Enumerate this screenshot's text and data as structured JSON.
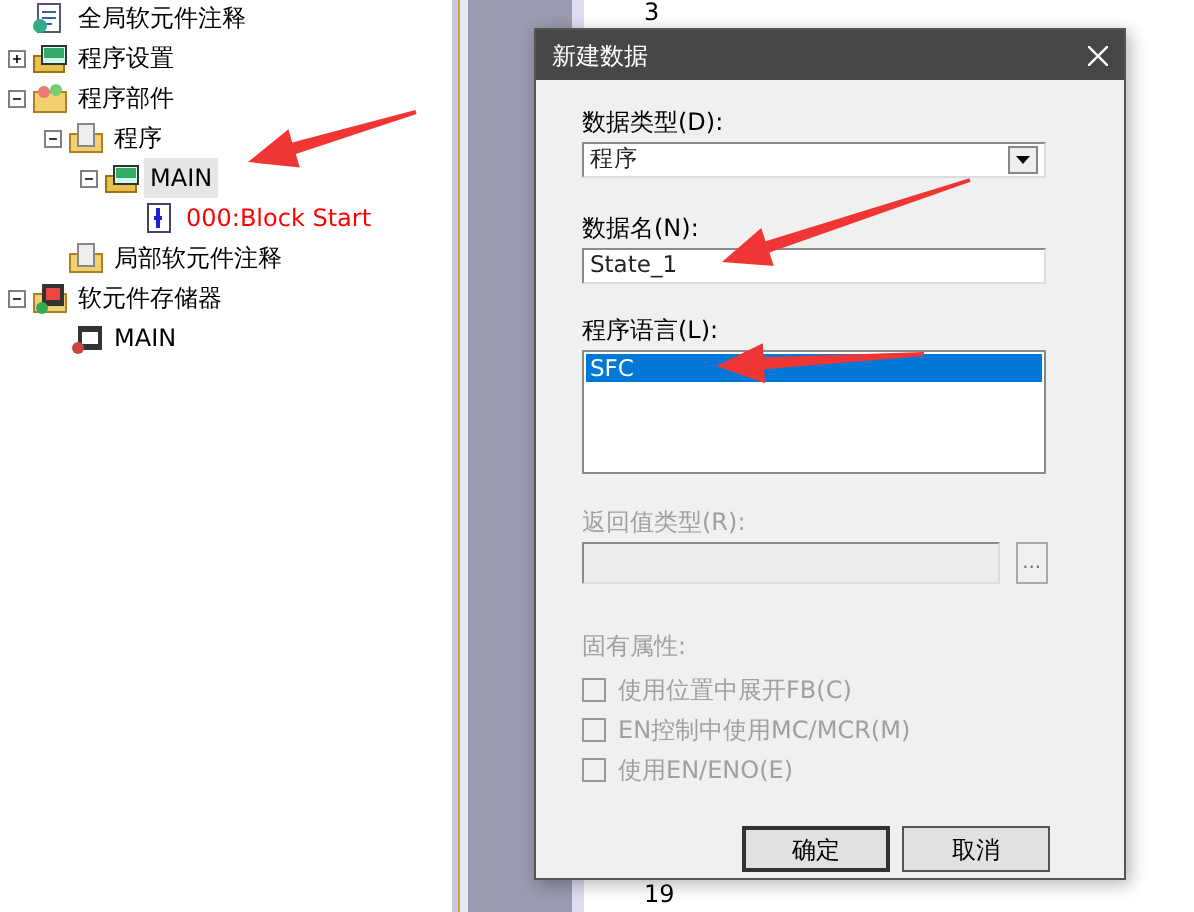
{
  "tree": [
    {
      "label": "全局软元件注释"
    },
    {
      "label": "程序设置",
      "expanded": false
    },
    {
      "label": "程序部件",
      "expanded": true,
      "children": [
        {
          "label": "程序",
          "expanded": true,
          "children": [
            {
              "label": "MAIN",
              "expanded": true,
              "selected": true,
              "children": [
                {
                  "label": "000:Block Start",
                  "color": "#ff0000"
                }
              ]
            }
          ]
        },
        {
          "label": "局部软元件注释"
        }
      ]
    },
    {
      "label": "软元件存储器",
      "expanded": true,
      "children": [
        {
          "label": "MAIN"
        }
      ]
    }
  ],
  "editor": {
    "line_numbers": [
      "3",
      "19"
    ]
  },
  "dialog": {
    "title": "新建数据",
    "data_type": {
      "label": "数据类型(D):",
      "value": "程序"
    },
    "data_name": {
      "label": "数据名(N):",
      "value": "State_1"
    },
    "language": {
      "label": "程序语言(L):",
      "items": [
        {
          "label": "SFC",
          "selected": true
        }
      ]
    },
    "return_type": {
      "label": "返回值类型(R):",
      "disabled": true,
      "browse": "..."
    },
    "attributes": {
      "label": "固有属性:",
      "disabled": true,
      "options": [
        {
          "label": "使用位置中展开FB(C)",
          "checked": false
        },
        {
          "label": "EN控制中使用MC/MCR(M)",
          "checked": false
        },
        {
          "label": "使用EN/ENO(E)",
          "checked": false
        }
      ]
    },
    "buttons": [
      "确定",
      "取消"
    ]
  },
  "annotations": [
    {
      "kind": "arrow"
    },
    {
      "kind": "arrow"
    },
    {
      "kind": "arrow"
    }
  ]
}
